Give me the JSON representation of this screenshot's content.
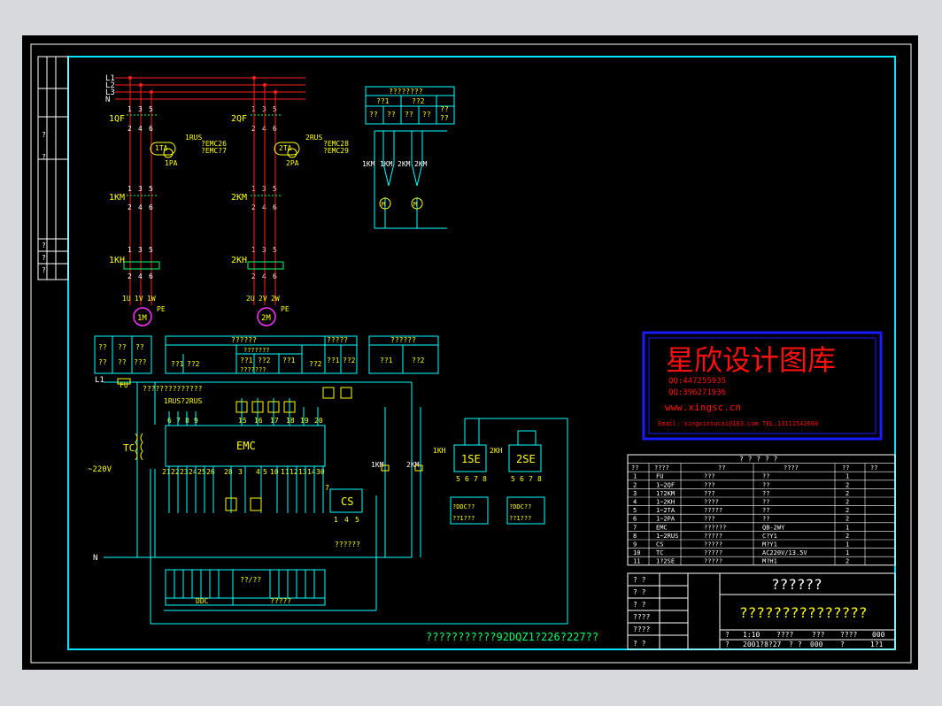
{
  "colors": {
    "background": "#000000",
    "frame": "#00e5ff",
    "border": "#ffffff",
    "power": "#ff2020",
    "control": "#00ffff",
    "label": "#ffffff",
    "highlight": "#ffff00",
    "green": "#00ff66",
    "magenta": "#ff33ff",
    "watermark_red": "#ff1010",
    "watermark_blue": "#1a1aff"
  },
  "phase_labels": [
    "L1",
    "L2",
    "L3",
    "N"
  ],
  "circuit1": {
    "breaker": "1QF",
    "contactor": "2KM",
    "contactor_a": "1KM",
    "relay": "1KH",
    "ta": "1TA",
    "pa": "1PA",
    "rus": "1RUS",
    "emc_a": "?EMC26",
    "emc_b": "?EMC?7",
    "motor": "1M",
    "terms": [
      "1U",
      "1V",
      "1W"
    ],
    "pe": "PE"
  },
  "circuit2": {
    "breaker": "2QF",
    "contactor": "2KM",
    "relay": "2KH",
    "ta": "2TA",
    "pa": "2PA",
    "rus": "2RUS",
    "emc_a": "?EMC28",
    "emc_b": "?EMC29",
    "motor": "2M",
    "terms": [
      "2U",
      "2V",
      "2W"
    ],
    "pe": "PE"
  },
  "pole_top": [
    "1",
    "3",
    "5"
  ],
  "pole_bottom": [
    "2",
    "4",
    "6"
  ],
  "top_table": {
    "header": "????????",
    "c1": "??1",
    "c2": "??2",
    "r1": "??",
    "r2": "??",
    "r3": "??",
    "r4": "??",
    "r5": "??",
    "r6": "??"
  },
  "control_motor": {
    "k1": "1KM",
    "k2": "1KM",
    "k3": "2KM",
    "k4": "2KM",
    "m": "M"
  },
  "control_section": {
    "l1": "L1",
    "n": "N",
    "fu": "FU",
    "tc": "TC",
    "voltage": "~220V",
    "question_row": "??????????????",
    "rus_label": "1RUS?2RUS",
    "emc": "EMC",
    "cs": "CS",
    "km1": "1KM",
    "km2": "2KM",
    "cs_bottom": "??????",
    "top_nums": [
      "6",
      "7",
      "8",
      "9",
      "15",
      "16",
      "17",
      "18",
      "19",
      "20"
    ],
    "emc_bottom_nums": [
      "21",
      "22",
      "23",
      "24",
      "25",
      "26",
      "28",
      "3",
      "4",
      "5",
      "10",
      "11",
      "12",
      "13",
      "14",
      "30"
    ],
    "cs_nums": [
      "7",
      "1",
      "4",
      "5"
    ]
  },
  "box_a": {
    "c1": "??",
    "c2": "??",
    "c3": "??",
    "r1": "??",
    "r2": "??",
    "r3": "???"
  },
  "box_b": {
    "title": "??????",
    "sub1": "???????",
    "sub2": "???????",
    "c1": "??1",
    "c2": "??2",
    "c3": "??1",
    "c4": "??2",
    "c5": "??1",
    "c6": "??2",
    "c7": "??1",
    "c8": "??2",
    "mid": "?????",
    "mid2": "?????"
  },
  "box_c": {
    "title": "??????",
    "c1": "??1",
    "c2": "??2"
  },
  "sensors": {
    "kh1": "1KH",
    "kh2": "2KH",
    "se1": "1SE",
    "se2": "2SE",
    "nums": [
      "5",
      "6",
      "7",
      "8"
    ],
    "ddc1": "?DDC??",
    "ddc2": "?DDC??",
    "code": "??1???"
  },
  "ddc_table": {
    "label": "DDC",
    "label2": "??/??",
    "label3": "?????"
  },
  "watermark": {
    "title": "星欣设计图库",
    "qq1": "QQ:447255935",
    "qq2": "QQ:396271936",
    "site": "www.xingsc.cn",
    "contact": "Email: xingxinsucai@163.com  TEL:13111542600"
  },
  "parts_table": {
    "header": [
      "??",
      "????",
      "??",
      "????",
      "??",
      "??"
    ],
    "top_title": "?  ?  ?  ?  ?",
    "rows": [
      [
        "1",
        "FU",
        "???",
        "??",
        "1"
      ],
      [
        "2",
        "1~2QF",
        "???",
        "??",
        "2"
      ],
      [
        "3",
        "1?2KM",
        "???",
        "??",
        "2"
      ],
      [
        "4",
        "1~2KH",
        "????",
        "??",
        "2"
      ],
      [
        "5",
        "1~2TA",
        "?????",
        "??",
        "2"
      ],
      [
        "6",
        "1~2PA",
        "???",
        "??",
        "2"
      ],
      [
        "7",
        "EMC",
        "??????",
        "QB-2WY",
        "1"
      ],
      [
        "8",
        "1~2RUS",
        "?????",
        "C?Y1",
        "2"
      ],
      [
        "9",
        "CS",
        "?????",
        "M?Y1",
        "1"
      ],
      [
        "10",
        "TC",
        "?????",
        "AC220V/13.5V",
        "1"
      ],
      [
        "11",
        "1?2SE",
        "?????",
        "M?H1",
        "2"
      ]
    ]
  },
  "title_block": {
    "big1": "??????",
    "big2": "???????????????",
    "left_rows": [
      "?   ?",
      "?   ?",
      "?   ?",
      "????",
      "????",
      "?   ?"
    ],
    "bottom1": [
      "?",
      "1:10",
      "????",
      "???",
      "????",
      "000"
    ],
    "bottom2": [
      "?",
      "2001?8?27",
      "?",
      "?",
      "000",
      "?",
      "1?1"
    ]
  },
  "footer_caption": "???????????92DQZ1?226?227??",
  "left_strip": [
    "?",
    "?",
    "?",
    "?",
    "?"
  ]
}
